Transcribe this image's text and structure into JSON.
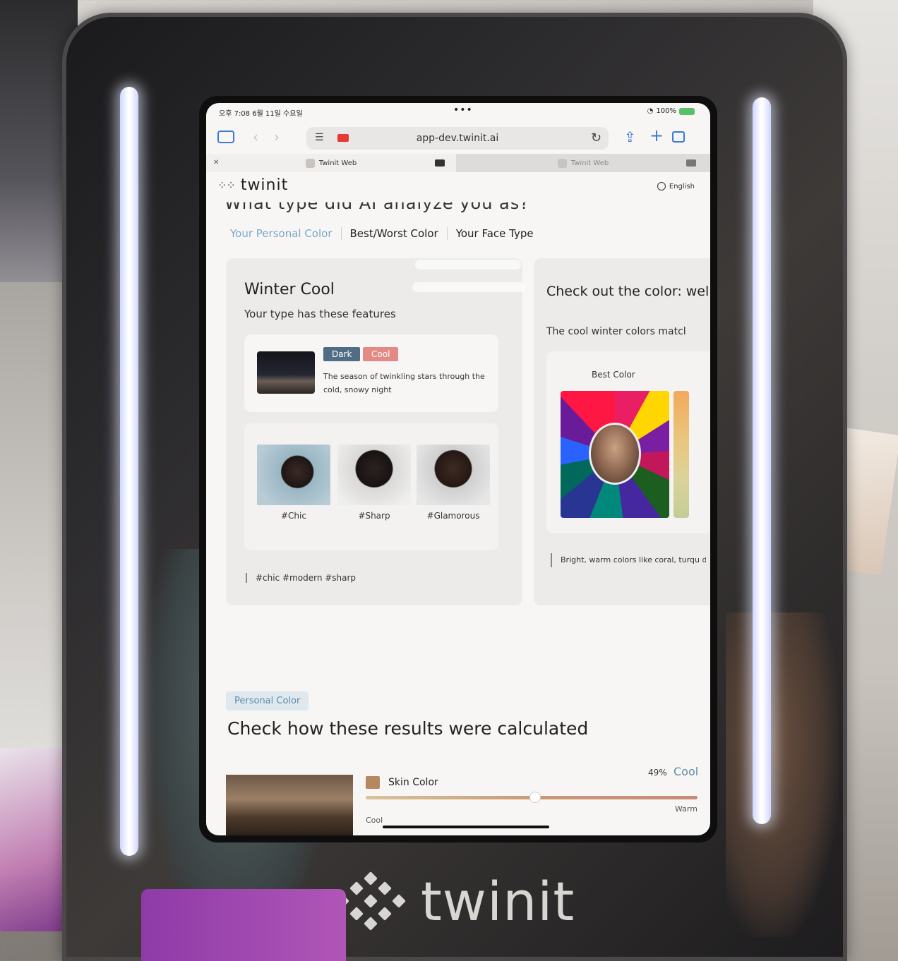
{
  "browser": {
    "status_time": "오후 7:08  6월 11일 수요일",
    "status_battery": "100%",
    "url": "app-dev.twinit.ai",
    "tabs": [
      {
        "label": "Twinit Web"
      },
      {
        "label": "Twinit Web"
      }
    ]
  },
  "site": {
    "logo_text": "twinit",
    "language": "English",
    "cut_heading": "What type did AI analyze you as?",
    "subtabs": [
      "Your Personal Color",
      "Best/Worst Color",
      "Your Face Type"
    ]
  },
  "type_panel": {
    "title": "Winter Cool",
    "subtitle": "Your type has these features",
    "chips": [
      "Dark",
      "Cool"
    ],
    "description": "The season of twinkling stars through the cold, snowy night",
    "portraits": [
      "#Chic",
      "#Sharp",
      "#Glamorous"
    ],
    "hashtags": "#chic #modern #sharp"
  },
  "color_panel": {
    "title": "Check out the color: well!",
    "subtitle": "The cool winter colors matcl",
    "best_label": "Best Color",
    "note": "Bright, warm colors like coral, turqu don't seem fit to you"
  },
  "calculation": {
    "pill": "Personal Color",
    "title": "Check how these results were calculated",
    "skin_label": "Skin Color",
    "percent": "49%",
    "type": "Cool",
    "warm_label": "Warm",
    "cool_label": "Cool",
    "slider_value": 0.49
  },
  "mirror_logo": "twinit",
  "colors": {
    "accent_blue": "#7aa7c8",
    "chip_dark": "#4f6e86",
    "chip_cool": "#e38a86",
    "skin_swatch": "#b58862"
  }
}
